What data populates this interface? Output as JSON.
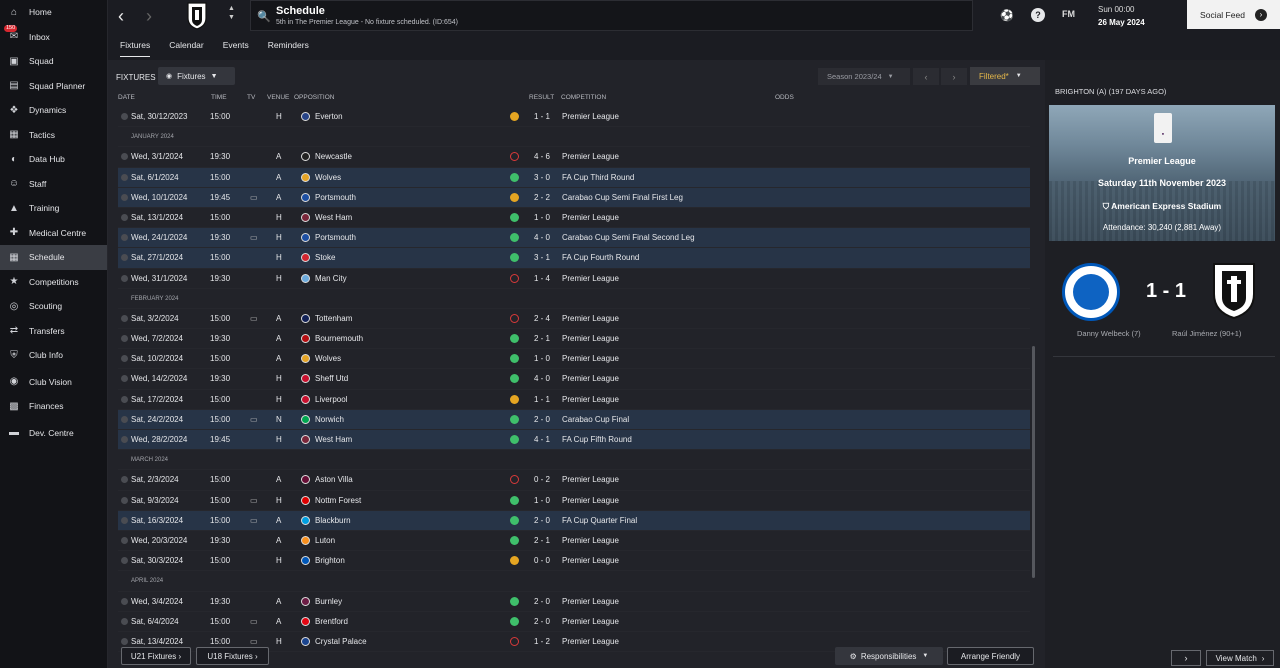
{
  "sidebar": {
    "items": [
      {
        "label": "Home",
        "icon": "home-icon"
      },
      {
        "label": "Inbox",
        "icon": "inbox-icon",
        "badge": "150"
      },
      {
        "label": "Squad",
        "icon": "shirt-icon"
      },
      {
        "label": "Squad Planner",
        "icon": "clipboard-icon"
      },
      {
        "label": "Dynamics",
        "icon": "dynamics-icon"
      },
      {
        "label": "Tactics",
        "icon": "tactics-icon"
      },
      {
        "label": "Data Hub",
        "icon": "data-hub-icon"
      },
      {
        "label": "Staff",
        "icon": "staff-icon"
      },
      {
        "label": "Training",
        "icon": "training-icon"
      },
      {
        "label": "Medical Centre",
        "icon": "medical-icon"
      },
      {
        "label": "Schedule",
        "icon": "calendar-icon"
      },
      {
        "label": "Competitions",
        "icon": "trophy-icon"
      },
      {
        "label": "Scouting",
        "icon": "scouting-icon"
      },
      {
        "label": "Transfers",
        "icon": "transfers-icon"
      },
      {
        "label": "Club Info",
        "icon": "shield-icon"
      },
      {
        "label": "Club Vision",
        "icon": "vision-icon"
      },
      {
        "label": "Finances",
        "icon": "finances-icon"
      },
      {
        "label": "Dev. Centre",
        "icon": "dev-centre-icon"
      }
    ],
    "active": "Schedule"
  },
  "header": {
    "title": "Schedule",
    "subtitle": "5th in The Premier League - No fixture scheduled. (ID:654)",
    "fm_label": "FM",
    "time": "Sun 00:00",
    "date": "26 May 2024",
    "social_feed": "Social Feed"
  },
  "tabs": [
    "Fixtures",
    "Calendar",
    "Events",
    "Reminders"
  ],
  "toolbar": {
    "fixtures_label": "FIXTURES",
    "fixtures_dropdown": "Fixtures",
    "season": "Season 2023/24",
    "filtered": "Filtered*"
  },
  "table": {
    "headers": {
      "date": "DATE",
      "time": "TIME",
      "tv": "TV",
      "venue": "VENUE",
      "opposition": "OPPOSITION",
      "result": "RESULT",
      "competition": "COMPETITION",
      "odds": "ODDS"
    },
    "rows": [
      {
        "type": "fixture",
        "date": "Sat, 30/12/2023",
        "time": "15:00",
        "tv": false,
        "venue": "H",
        "opp": "Everton",
        "oppColor": "#274488",
        "outcome": "d",
        "score": "1 - 1",
        "comp": "Premier League",
        "hl": false
      },
      {
        "type": "month",
        "label": "JANUARY 2024"
      },
      {
        "type": "fixture",
        "date": "Wed, 3/1/2024",
        "time": "19:30",
        "tv": false,
        "venue": "A",
        "opp": "Newcastle",
        "oppColor": "#222222",
        "outcome": "l",
        "score": "4 - 6",
        "comp": "Premier League",
        "hl": false
      },
      {
        "type": "fixture",
        "date": "Sat, 6/1/2024",
        "time": "15:00",
        "tv": false,
        "venue": "A",
        "opp": "Wolves",
        "oppColor": "#e4a325",
        "outcome": "w",
        "score": "3 - 0",
        "comp": "FA Cup Third Round",
        "hl": true
      },
      {
        "type": "fixture",
        "date": "Wed, 10/1/2024",
        "time": "19:45",
        "tv": true,
        "venue": "A",
        "opp": "Portsmouth",
        "oppColor": "#1d4fa3",
        "outcome": "d",
        "score": "2 - 2",
        "comp": "Carabao Cup Semi Final First Leg",
        "hl": true
      },
      {
        "type": "fixture",
        "date": "Sat, 13/1/2024",
        "time": "15:00",
        "tv": false,
        "venue": "H",
        "opp": "West Ham",
        "oppColor": "#7a263a",
        "outcome": "w",
        "score": "1 - 0",
        "comp": "Premier League",
        "hl": false
      },
      {
        "type": "fixture",
        "date": "Wed, 24/1/2024",
        "time": "19:30",
        "tv": true,
        "venue": "H",
        "opp": "Portsmouth",
        "oppColor": "#1d4fa3",
        "outcome": "w",
        "score": "4 - 0",
        "comp": "Carabao Cup Semi Final Second Leg",
        "hl": true
      },
      {
        "type": "fixture",
        "date": "Sat, 27/1/2024",
        "time": "15:00",
        "tv": false,
        "venue": "H",
        "opp": "Stoke",
        "oppColor": "#d22630",
        "outcome": "w",
        "score": "3 - 1",
        "comp": "FA Cup Fourth Round",
        "hl": true
      },
      {
        "type": "fixture",
        "date": "Wed, 31/1/2024",
        "time": "19:30",
        "tv": false,
        "venue": "H",
        "opp": "Man City",
        "oppColor": "#6cabdd",
        "outcome": "l",
        "score": "1 - 4",
        "comp": "Premier League",
        "hl": false
      },
      {
        "type": "month",
        "label": "FEBRUARY 2024"
      },
      {
        "type": "fixture",
        "date": "Sat, 3/2/2024",
        "time": "15:00",
        "tv": true,
        "venue": "A",
        "opp": "Tottenham",
        "oppColor": "#132257",
        "outcome": "l",
        "score": "2 - 4",
        "comp": "Premier League",
        "hl": false
      },
      {
        "type": "fixture",
        "date": "Wed, 7/2/2024",
        "time": "19:30",
        "tv": false,
        "venue": "A",
        "opp": "Bournemouth",
        "oppColor": "#b50e12",
        "outcome": "w",
        "score": "2 - 1",
        "comp": "Premier League",
        "hl": false
      },
      {
        "type": "fixture",
        "date": "Sat, 10/2/2024",
        "time": "15:00",
        "tv": false,
        "venue": "A",
        "opp": "Wolves",
        "oppColor": "#e4a325",
        "outcome": "w",
        "score": "1 - 0",
        "comp": "Premier League",
        "hl": false
      },
      {
        "type": "fixture",
        "date": "Wed, 14/2/2024",
        "time": "19:30",
        "tv": false,
        "venue": "H",
        "opp": "Sheff Utd",
        "oppColor": "#c8102e",
        "outcome": "w",
        "score": "4 - 0",
        "comp": "Premier League",
        "hl": false
      },
      {
        "type": "fixture",
        "date": "Sat, 17/2/2024",
        "time": "15:00",
        "tv": false,
        "venue": "H",
        "opp": "Liverpool",
        "oppColor": "#c8102e",
        "outcome": "d",
        "score": "1 - 1",
        "comp": "Premier League",
        "hl": false
      },
      {
        "type": "fixture",
        "date": "Sat, 24/2/2024",
        "time": "15:00",
        "tv": true,
        "venue": "N",
        "opp": "Norwich",
        "oppColor": "#00a650",
        "outcome": "w",
        "score": "2 - 0",
        "comp": "Carabao Cup Final",
        "hl": true
      },
      {
        "type": "fixture",
        "date": "Wed, 28/2/2024",
        "time": "19:45",
        "tv": false,
        "venue": "H",
        "opp": "West Ham",
        "oppColor": "#7a263a",
        "outcome": "w",
        "score": "4 - 1",
        "comp": "FA Cup Fifth Round",
        "hl": true
      },
      {
        "type": "month",
        "label": "MARCH 2024"
      },
      {
        "type": "fixture",
        "date": "Sat, 2/3/2024",
        "time": "15:00",
        "tv": false,
        "venue": "A",
        "opp": "Aston Villa",
        "oppColor": "#670e36",
        "outcome": "l",
        "score": "0 - 2",
        "comp": "Premier League",
        "hl": false
      },
      {
        "type": "fixture",
        "date": "Sat, 9/3/2024",
        "time": "15:00",
        "tv": true,
        "venue": "H",
        "opp": "Nottm Forest",
        "oppColor": "#dd0000",
        "outcome": "w",
        "score": "1 - 0",
        "comp": "Premier League",
        "hl": false
      },
      {
        "type": "fixture",
        "date": "Sat, 16/3/2024",
        "time": "15:00",
        "tv": true,
        "venue": "A",
        "opp": "Blackburn",
        "oppColor": "#009ee0",
        "outcome": "w",
        "score": "2 - 0",
        "comp": "FA Cup Quarter Final",
        "hl": true
      },
      {
        "type": "fixture",
        "date": "Wed, 20/3/2024",
        "time": "19:30",
        "tv": false,
        "venue": "A",
        "opp": "Luton",
        "oppColor": "#f78f1e",
        "outcome": "w",
        "score": "2 - 1",
        "comp": "Premier League",
        "hl": false
      },
      {
        "type": "fixture",
        "date": "Sat, 30/3/2024",
        "time": "15:00",
        "tv": false,
        "venue": "H",
        "opp": "Brighton",
        "oppColor": "#0057b8",
        "outcome": "d",
        "score": "0 - 0",
        "comp": "Premier League",
        "hl": false
      },
      {
        "type": "month",
        "label": "APRIL 2024"
      },
      {
        "type": "fixture",
        "date": "Wed, 3/4/2024",
        "time": "19:30",
        "tv": false,
        "venue": "A",
        "opp": "Burnley",
        "oppColor": "#6c1d45",
        "outcome": "w",
        "score": "2 - 0",
        "comp": "Premier League",
        "hl": false
      },
      {
        "type": "fixture",
        "date": "Sat, 6/4/2024",
        "time": "15:00",
        "tv": true,
        "venue": "A",
        "opp": "Brentford",
        "oppColor": "#e30613",
        "outcome": "w",
        "score": "2 - 0",
        "comp": "Premier League",
        "hl": false
      },
      {
        "type": "fixture",
        "date": "Sat, 13/4/2024",
        "time": "15:00",
        "tv": true,
        "venue": "H",
        "opp": "Crystal Palace",
        "oppColor": "#1b458f",
        "outcome": "l",
        "score": "1 - 2",
        "comp": "Premier League",
        "hl": false
      }
    ]
  },
  "bottom": {
    "u21": "U21 Fixtures",
    "u18": "U18 Fixtures",
    "responsibilities": "Responsibilities",
    "arrange": "Arrange Friendly"
  },
  "right_panel": {
    "title": "BRIGHTON (A) (197 DAYS AGO)",
    "competition": "Premier League",
    "date": "Saturday 11th November 2023",
    "stadium": "American Express Stadium",
    "attendance": "Attendance: 30,240 (2,881 Away)",
    "score": "1 - 1",
    "home_scorer": "Danny Welbeck (7)",
    "away_scorer": "Raúl Jiménez (90+1)",
    "view_match": "View Match"
  },
  "colors": {
    "win": "#3fbf6b",
    "draw": "#e5a522",
    "loss": "#d93a3a",
    "highlight": "#273447",
    "filtered": "#e5b84a"
  }
}
